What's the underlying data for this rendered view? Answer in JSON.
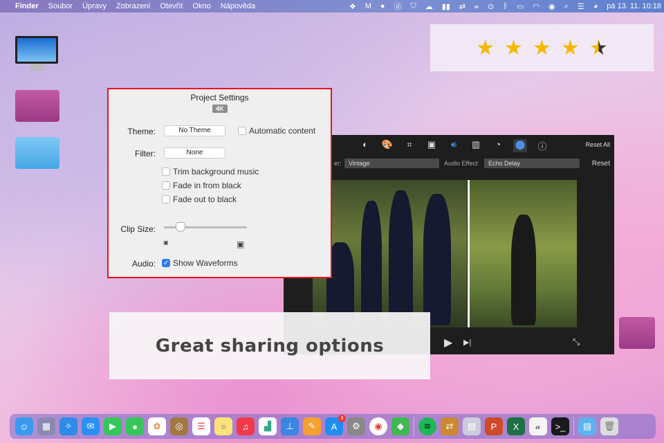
{
  "menubar": {
    "apple": "",
    "items": [
      "Finder",
      "Soubor",
      "Úpravy",
      "Zobrazení",
      "Otevřít",
      "Okno",
      "Nápověda"
    ],
    "clock": "pá 13. 11.  10:18"
  },
  "rating": {
    "value": 4.5,
    "max": 5,
    "star": "★"
  },
  "project_settings": {
    "title": "Project Settings",
    "badge": "4K",
    "theme_label": "Theme:",
    "theme_value": "No Theme",
    "auto_content": "Automatic content",
    "filter_label": "Filter:",
    "filter_value": "None",
    "trim": "Trim background music",
    "fade_in": "Fade in from black",
    "fade_out": "Fade out to black",
    "clip_size_label": "Clip Size:",
    "clip_size_fraction": 0.2,
    "audio_label": "Audio:",
    "show_waveforms": "Show Waveforms",
    "show_waveforms_checked": true
  },
  "imovie": {
    "reset_all": "Reset All",
    "filter_label": "er:",
    "filter_value": "Vintage",
    "audio_effect_label": "Audio Effect:",
    "audio_effect_value": "Echo Delay",
    "reset": "Reset"
  },
  "banner": {
    "text": "Great sharing options"
  },
  "dock": {
    "appstore_badge": "3"
  }
}
